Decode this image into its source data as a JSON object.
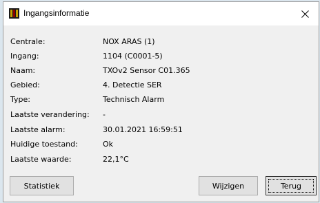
{
  "window": {
    "title": "Ingangsinformatie",
    "close_glyph": "✕",
    "icon": "app-bars-icon",
    "accent": "#8b0000"
  },
  "info": [
    {
      "label": "Centrale:",
      "value": "NOX ARAS (1)"
    },
    {
      "label": "Ingang:",
      "value": "1104 (C0001-5)"
    },
    {
      "label": "Naam:",
      "value": "TXOv2 Sensor C01.365"
    },
    {
      "label": "Gebied:",
      "value": "4. Detectie SER"
    },
    {
      "label": "Type:",
      "value": "Technisch Alarm"
    },
    {
      "label": "Laatste verandering:",
      "value": "-"
    },
    {
      "label": "Laatste alarm:",
      "value": "30.01.2021 16:59:51"
    },
    {
      "label": "Huidige toestand:",
      "value": "Ok"
    },
    {
      "label": "Laatste waarde:",
      "value": "22,1°C"
    }
  ],
  "buttons": {
    "statistiek": "Statistiek",
    "wijzigen": "Wijzigen",
    "terug": "Terug"
  }
}
